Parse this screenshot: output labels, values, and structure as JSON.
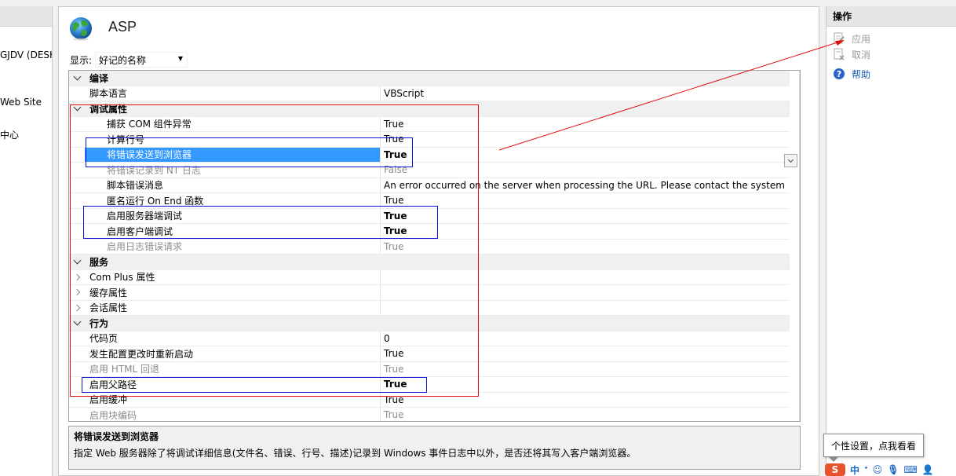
{
  "left_panel": {
    "lines": [
      "GJDV (DESK",
      "Web Site",
      "中心"
    ]
  },
  "header": {
    "title": "ASP",
    "display_label": "显示:",
    "display_value": "好记的名称"
  },
  "grid": {
    "rows": [
      {
        "kind": "cat",
        "name": "编译",
        "value": ""
      },
      {
        "kind": "prop",
        "name": "脚本语言",
        "value": "VBScript"
      },
      {
        "kind": "cat",
        "name": "调试属性",
        "value": ""
      },
      {
        "kind": "sub",
        "name": "捕获 COM 组件异常",
        "value": "True"
      },
      {
        "kind": "sub",
        "name": "计算行号",
        "value": "True"
      },
      {
        "kind": "sub",
        "name": "将错误发送到浏览器",
        "value": "True"
      },
      {
        "kind": "sub",
        "name": "将错误记录到 NT 日志",
        "value": "False"
      },
      {
        "kind": "sub",
        "name": "脚本错误消息",
        "value": "An error occurred on the server when processing the URL. Please contact the system"
      },
      {
        "kind": "sub",
        "name": "匿名运行 On End 函数",
        "value": "True"
      },
      {
        "kind": "sub",
        "name": "启用服务器端调试",
        "value": "True"
      },
      {
        "kind": "sub",
        "name": "启用客户端调试",
        "value": "True"
      },
      {
        "kind": "sub",
        "name": "启用日志错误请求",
        "value": "True"
      },
      {
        "kind": "cat",
        "name": "服务",
        "value": ""
      },
      {
        "kind": "collapsed",
        "name": "Com Plus 属性",
        "value": ""
      },
      {
        "kind": "collapsed",
        "name": "缓存属性",
        "value": ""
      },
      {
        "kind": "collapsed",
        "name": "会话属性",
        "value": ""
      },
      {
        "kind": "cat",
        "name": "行为",
        "value": ""
      },
      {
        "kind": "prop",
        "name": "代码页",
        "value": "0"
      },
      {
        "kind": "prop",
        "name": "发生配置更改时重新启动",
        "value": "True"
      },
      {
        "kind": "prop",
        "name": "启用 HTML 回退",
        "value": "True"
      },
      {
        "kind": "prop",
        "name": "启用父路径",
        "value": "True"
      },
      {
        "kind": "prop",
        "name": "启用缓冲",
        "value": "True"
      },
      {
        "kind": "prop",
        "name": "启用块编码",
        "value": "True"
      }
    ]
  },
  "description": {
    "title": "将错误发送到浏览器",
    "text": "指定 Web 服务器除了将调试详细信息(文件名、错误、行号、描述)记录到 Windows 事件日志中以外，是否还将其写入客户端浏览器。"
  },
  "actions": {
    "header": "操作",
    "apply": "应用",
    "cancel": "取消",
    "help": "帮助"
  },
  "tooltip": "个性设置，点我看看",
  "ime": {
    "logo": "S",
    "lang": "中"
  },
  "colors": {
    "selection": "#3399ff",
    "annotation_red": "#e01010",
    "annotation_blue": "#0a14d8",
    "link": "#1a5fb4"
  }
}
